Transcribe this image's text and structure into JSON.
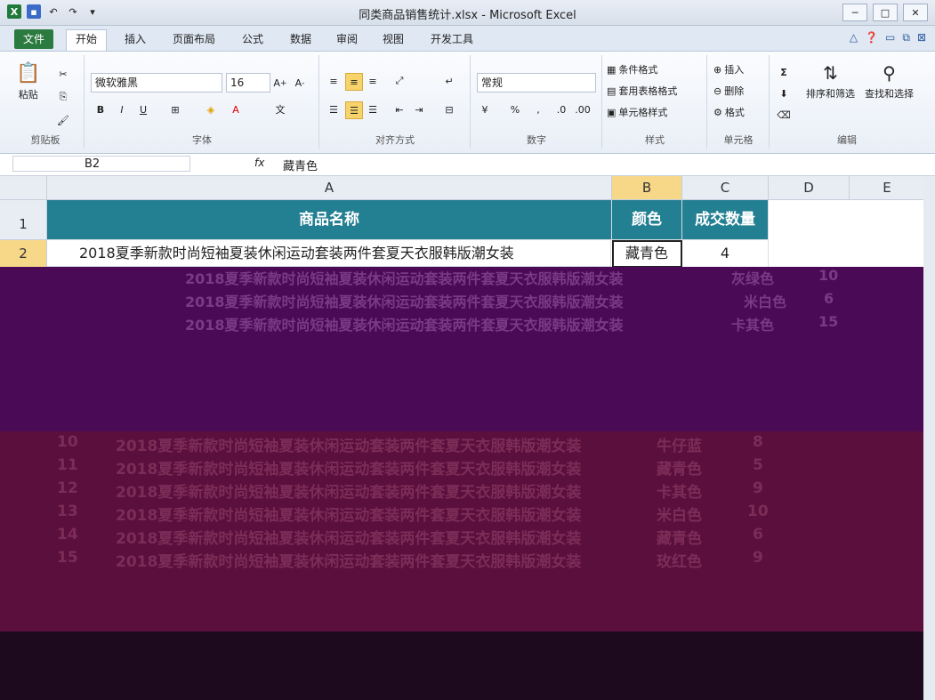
{
  "window": {
    "title": "同类商品销售统计.xlsx - Microsoft Excel"
  },
  "tabs": [
    "文件",
    "开始",
    "插入",
    "页面布局",
    "公式",
    "数据",
    "审阅",
    "视图",
    "开发工具"
  ],
  "ribbon": {
    "clipboard": {
      "label": "剪贴板",
      "paste": "粘贴"
    },
    "font": {
      "label": "字体",
      "name": "微软雅黑",
      "size": "16",
      "bold": "B",
      "italic": "I",
      "underline": "U"
    },
    "alignment": {
      "label": "对齐方式"
    },
    "number": {
      "label": "数字",
      "format": "常规",
      "percent": "%",
      "comma": ","
    },
    "styles": {
      "label": "样式",
      "conditional": "条件格式",
      "table": "套用表格格式",
      "cell": "单元格样式"
    },
    "cells": {
      "label": "单元格",
      "insert": "插入",
      "delete": "删除",
      "format": "格式"
    },
    "editing": {
      "label": "编辑",
      "sort": "排序和筛选",
      "find": "查找和选择",
      "sum": "Σ"
    }
  },
  "formula_bar": {
    "cell_ref": "B2",
    "fx": "fx",
    "value": "藏青色"
  },
  "columns": [
    "A",
    "B",
    "C",
    "D",
    "E"
  ],
  "header_row": {
    "row": "1",
    "product": "商品名称",
    "color": "颜色",
    "qty": "成交数量"
  },
  "row2": {
    "row": "2",
    "product": "2018夏季新款时尚短袖夏装休闲运动套装两件套夏天衣服韩版潮女装",
    "color": "藏青色",
    "qty": "4"
  },
  "visible_rows": [
    {
      "row": "10",
      "product": "2018夏季新款时尚短袖夏装休闲运动套装两件套夏天衣服韩版潮女装",
      "color": "牛仔蓝",
      "qty": "8"
    },
    {
      "row": "11",
      "product": "2018夏季新款时尚短袖夏装休闲运动套装两件套夏天衣服韩版潮女装",
      "color": "藏青色",
      "qty": "5"
    },
    {
      "row": "12",
      "product": "2018夏季新款时尚短袖夏装休闲运动套装两件套夏天衣服韩版潮女装",
      "color": "卡其色",
      "qty": "9"
    },
    {
      "row": "13",
      "product": "2018夏季新款时尚短袖夏装休闲运动套装两件套夏天衣服韩版潮女装",
      "color": "米白色",
      "qty": "10"
    },
    {
      "row": "14",
      "product": "2018夏季新款时尚短袖夏装休闲运动套装两件套夏天衣服韩版潮女装",
      "color": "藏青色",
      "qty": "6"
    },
    {
      "row": "15",
      "product": "2018夏季新款时尚短袖夏装休闲运动套装两件套夏天衣服韩版潮女装",
      "color": "玫红色",
      "qty": "9"
    }
  ],
  "ghost_rows": [
    {
      "product": "2018夏季新款时尚短袖夏装休闲运动套装两件套夏天衣服韩版潮女装",
      "color": "灰绿色",
      "qty": "10"
    },
    {
      "product": "2018夏季新款时尚短袖夏装休闲运动套装两件套夏天衣服韩版潮女装",
      "color": "米白色",
      "qty": "6"
    },
    {
      "product": "2018夏季新款时尚短袖夏装休闲运动套装两件套夏天衣服韩版潮女装",
      "color": "卡其色",
      "qty": "15"
    }
  ],
  "colors": {
    "header_fill": "#237f92",
    "active_header": "#f7d888",
    "glitch_purple": "#4a0a55",
    "glitch_magenta": "#5b0f3d"
  }
}
